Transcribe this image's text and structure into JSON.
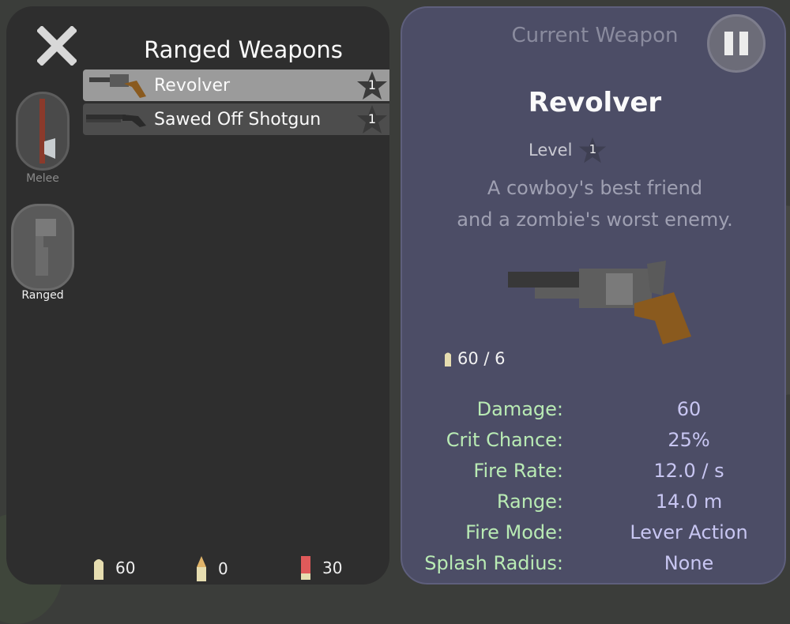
{
  "left_panel": {
    "title": "Ranged Weapons",
    "categories": [
      {
        "label": "Melee"
      },
      {
        "label": "Ranged"
      }
    ],
    "weapons": [
      {
        "name": "Revolver",
        "level": "1",
        "selected": true
      },
      {
        "name": "Sawed Off Shotgun",
        "level": "1",
        "selected": false
      }
    ],
    "ammo": [
      {
        "icon": "pistol-bullet-icon",
        "count": "60"
      },
      {
        "icon": "rifle-bullet-icon",
        "count": "0"
      },
      {
        "icon": "shotgun-shell-icon",
        "count": "30"
      }
    ]
  },
  "current_weapon": {
    "heading": "Current Weapon",
    "name": "Revolver",
    "level_label": "Level",
    "level": "1",
    "description_line1": "A cowboy's best friend",
    "description_line2": "and a zombie's worst enemy.",
    "ammo": "60 / 6",
    "stats": [
      {
        "label": "Damage:",
        "value": "60"
      },
      {
        "label": "Crit Chance:",
        "value": "25%"
      },
      {
        "label": "Fire Rate:",
        "value": "12.0 / s"
      },
      {
        "label": "Range:",
        "value": "14.0 m"
      },
      {
        "label": "Fire Mode:",
        "value": "Lever Action"
      },
      {
        "label": "Splash Radius:",
        "value": "None"
      }
    ]
  },
  "colors": {
    "left_panel_bg": "#2e2e2e",
    "right_panel_bg": "#4c4d66",
    "stat_label": "#b9ebb4",
    "stat_value": "#c8c6f2",
    "selected_row": "#9b9b9b",
    "unselected_row": "#4d4d4d"
  }
}
